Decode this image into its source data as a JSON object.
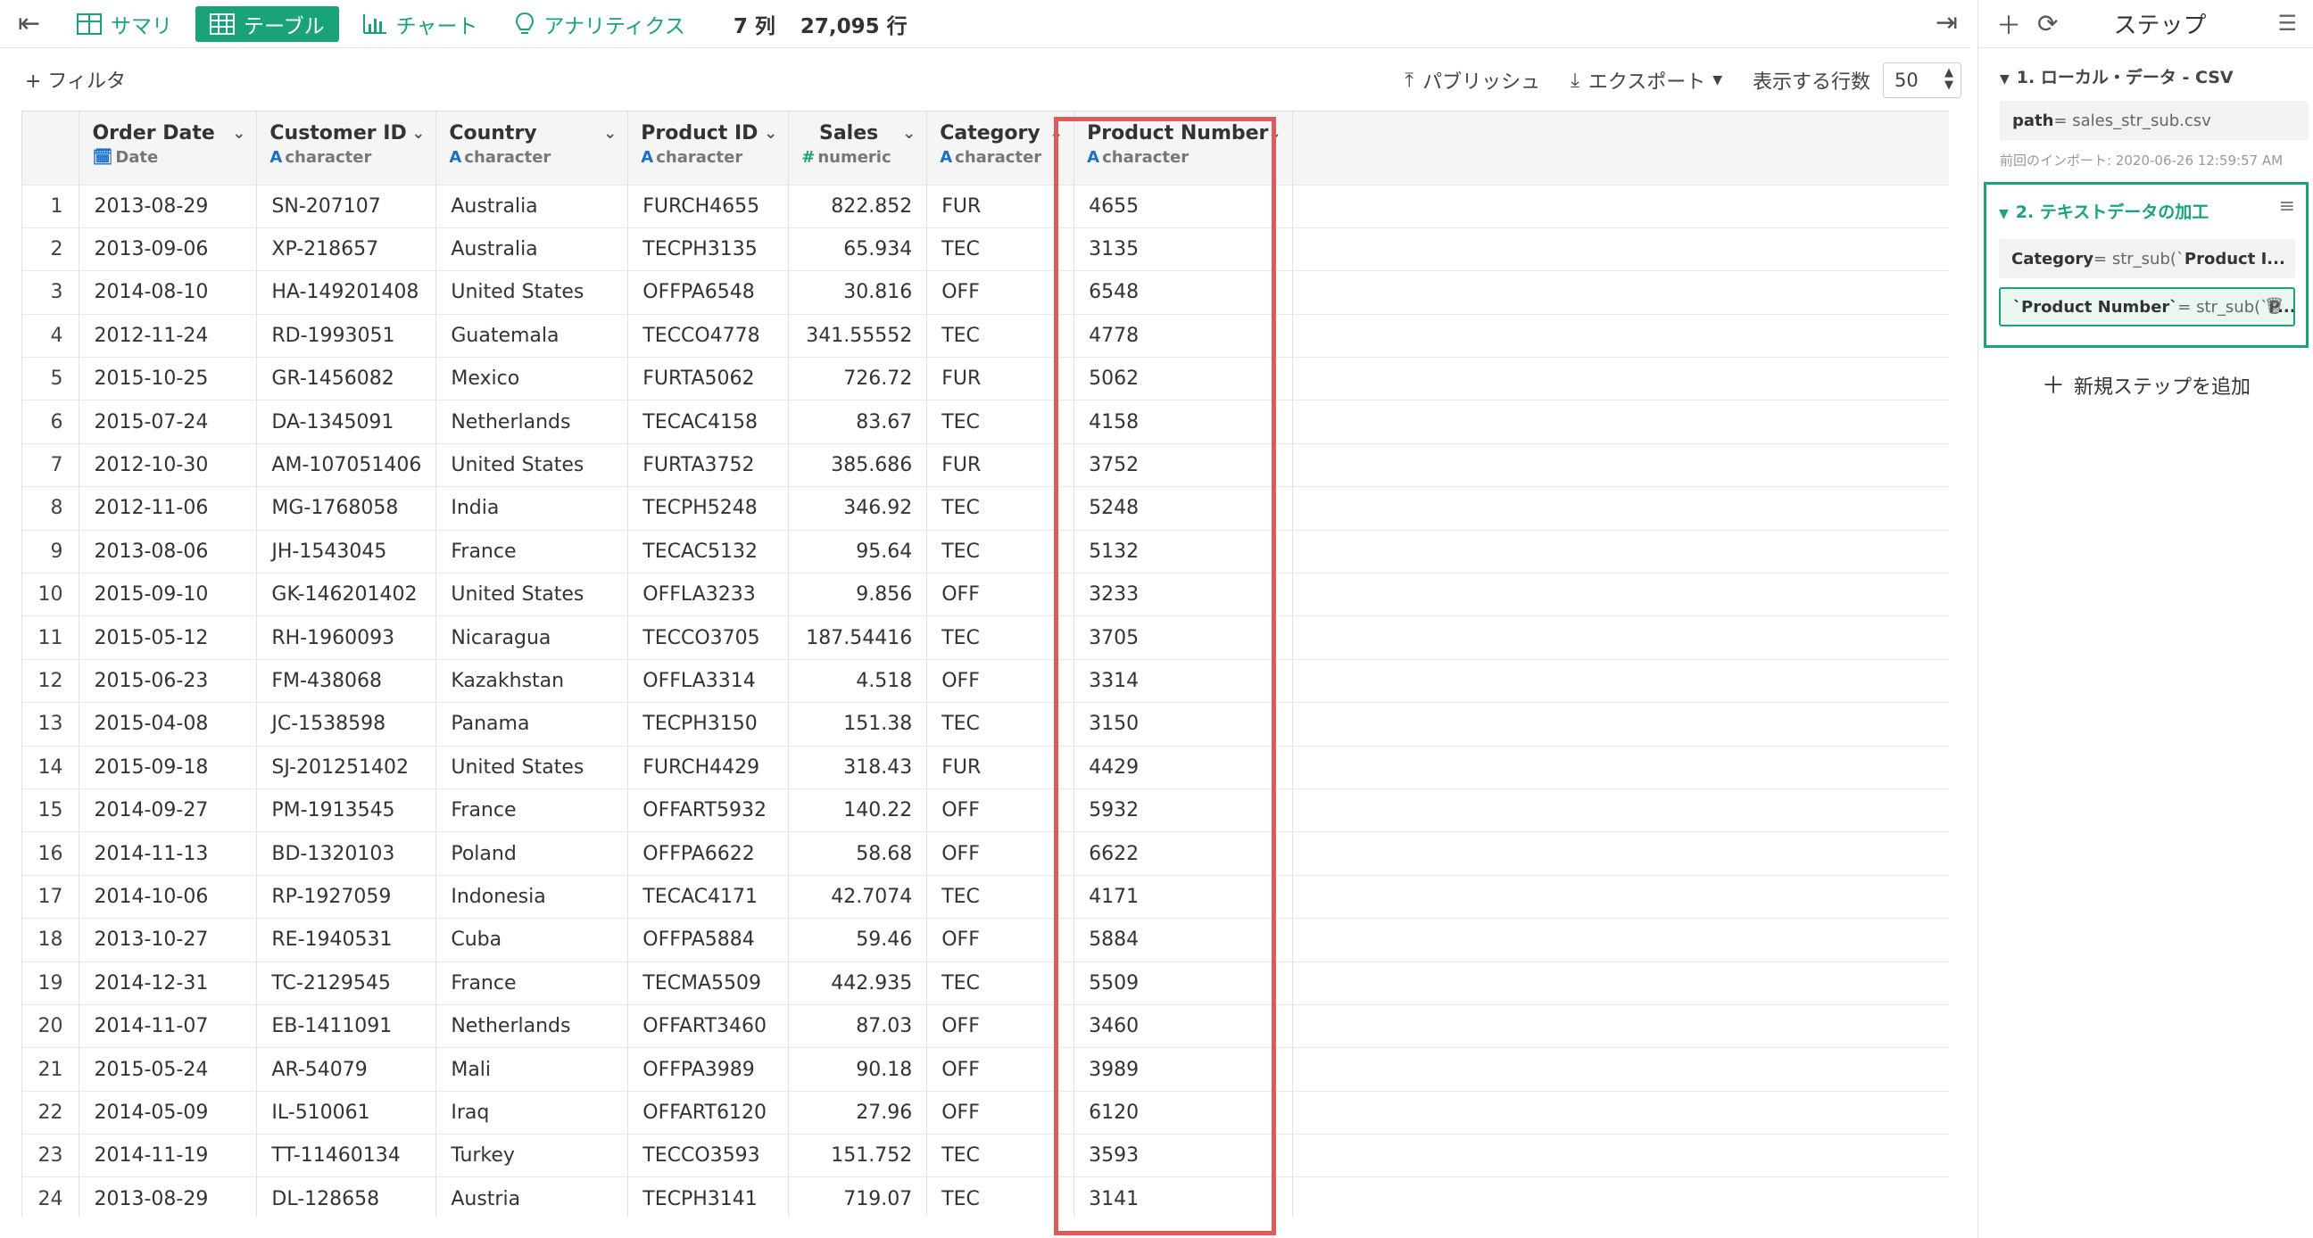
{
  "toolbar": {
    "collapse_icon": "collapse-left-icon",
    "tabs": [
      {
        "label": "サマリ",
        "icon": "grid-icon",
        "active": false
      },
      {
        "label": "テーブル",
        "icon": "table-icon",
        "active": true
      },
      {
        "label": "チャート",
        "icon": "bar-chart-icon",
        "active": false
      },
      {
        "label": "アナリティクス",
        "icon": "lightbulb-icon",
        "active": false
      }
    ],
    "columns_count": "7 列",
    "rows_count": "27,095 行"
  },
  "subbar": {
    "filter": "+ フィルタ",
    "publish": "パブリッシュ",
    "export": "エクスポート",
    "rows_label": "表示する行数",
    "rows_value": "50"
  },
  "table": {
    "columns": [
      {
        "name": "Order Date",
        "type": "Date",
        "type_tag": "date"
      },
      {
        "name": "Customer ID",
        "type": "character",
        "type_tag": "A"
      },
      {
        "name": "Country",
        "type": "character",
        "type_tag": "A"
      },
      {
        "name": "Product ID",
        "type": "character",
        "type_tag": "A"
      },
      {
        "name": "Sales",
        "type": "numeric",
        "type_tag": "#"
      },
      {
        "name": "Category",
        "type": "character",
        "type_tag": "A"
      },
      {
        "name": "Product Number",
        "type": "character",
        "type_tag": "A"
      }
    ],
    "rows": [
      [
        "1",
        "2013-08-29",
        "SN-207107",
        "Australia",
        "FURCH4655",
        "822.852",
        "FUR",
        "4655"
      ],
      [
        "2",
        "2013-09-06",
        "XP-218657",
        "Australia",
        "TECPH3135",
        "65.934",
        "TEC",
        "3135"
      ],
      [
        "3",
        "2014-08-10",
        "HA-149201408",
        "United States",
        "OFFPA6548",
        "30.816",
        "OFF",
        "6548"
      ],
      [
        "4",
        "2012-11-24",
        "RD-1993051",
        "Guatemala",
        "TECCO4778",
        "341.55552",
        "TEC",
        "4778"
      ],
      [
        "5",
        "2015-10-25",
        "GR-1456082",
        "Mexico",
        "FURTA5062",
        "726.72",
        "FUR",
        "5062"
      ],
      [
        "6",
        "2015-07-24",
        "DA-1345091",
        "Netherlands",
        "TECAC4158",
        "83.67",
        "TEC",
        "4158"
      ],
      [
        "7",
        "2012-10-30",
        "AM-107051406",
        "United States",
        "FURTA3752",
        "385.686",
        "FUR",
        "3752"
      ],
      [
        "8",
        "2012-11-06",
        "MG-1768058",
        "India",
        "TECPH5248",
        "346.92",
        "TEC",
        "5248"
      ],
      [
        "9",
        "2013-08-06",
        "JH-1543045",
        "France",
        "TECAC5132",
        "95.64",
        "TEC",
        "5132"
      ],
      [
        "10",
        "2015-09-10",
        "GK-146201402",
        "United States",
        "OFFLA3233",
        "9.856",
        "OFF",
        "3233"
      ],
      [
        "11",
        "2015-05-12",
        "RH-1960093",
        "Nicaragua",
        "TECCO3705",
        "187.54416",
        "TEC",
        "3705"
      ],
      [
        "12",
        "2015-06-23",
        "FM-438068",
        "Kazakhstan",
        "OFFLA3314",
        "4.518",
        "OFF",
        "3314"
      ],
      [
        "13",
        "2015-04-08",
        "JC-1538598",
        "Panama",
        "TECPH3150",
        "151.38",
        "TEC",
        "3150"
      ],
      [
        "14",
        "2015-09-18",
        "SJ-201251402",
        "United States",
        "FURCH4429",
        "318.43",
        "FUR",
        "4429"
      ],
      [
        "15",
        "2014-09-27",
        "PM-1913545",
        "France",
        "OFFART5932",
        "140.22",
        "OFF",
        "5932"
      ],
      [
        "16",
        "2014-11-13",
        "BD-1320103",
        "Poland",
        "OFFPA6622",
        "58.68",
        "OFF",
        "6622"
      ],
      [
        "17",
        "2014-10-06",
        "RP-1927059",
        "Indonesia",
        "TECAC4171",
        "42.7074",
        "TEC",
        "4171"
      ],
      [
        "18",
        "2013-10-27",
        "RE-1940531",
        "Cuba",
        "OFFPA5884",
        "59.46",
        "OFF",
        "5884"
      ],
      [
        "19",
        "2014-12-31",
        "TC-2129545",
        "France",
        "TECMA5509",
        "442.935",
        "TEC",
        "5509"
      ],
      [
        "20",
        "2014-11-07",
        "EB-1411091",
        "Netherlands",
        "OFFART3460",
        "87.03",
        "OFF",
        "3460"
      ],
      [
        "21",
        "2015-05-24",
        "AR-54079",
        "Mali",
        "OFFPA3989",
        "90.18",
        "OFF",
        "3989"
      ],
      [
        "22",
        "2014-05-09",
        "IL-510061",
        "Iraq",
        "OFFART6120",
        "27.96",
        "OFF",
        "6120"
      ],
      [
        "23",
        "2014-11-19",
        "TT-11460134",
        "Turkey",
        "TECCO3593",
        "151.752",
        "TEC",
        "3593"
      ],
      [
        "24",
        "2013-08-29",
        "DL-128658",
        "Austria",
        "TECPH3141",
        "719.07",
        "TEC",
        "3141"
      ]
    ]
  },
  "panel": {
    "title": "ステップ",
    "step1": {
      "title": "1. ローカル・データ - CSV",
      "code_key": "path",
      "code_rest": " = sales_str_sub.csv",
      "note": "前回のインポート: 2020-06-26 12:59:57 AM"
    },
    "step2": {
      "title": "2. テキストデータの加工",
      "line1_key": "Category",
      "line1_rest": " = str_sub(`",
      "line1_tail": "Product I...",
      "line2_key": "`Product Number`",
      "line2_rest": " = str_sub(`",
      "line2_tail": "P..."
    },
    "add_step": "新規ステップを追加"
  },
  "colors": {
    "accent": "#1aa37a",
    "highlight": "#e05a5a",
    "character_tag": "#1a6fc9"
  }
}
